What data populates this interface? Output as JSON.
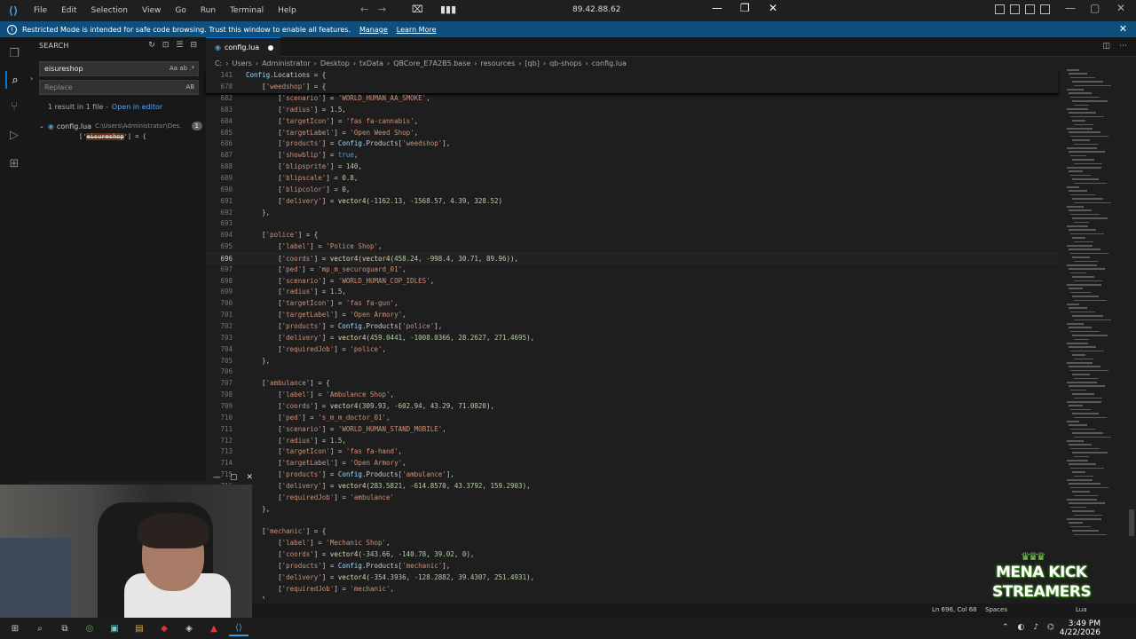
{
  "titlebar": {
    "menu": [
      "File",
      "Edit",
      "Selection",
      "View",
      "Go",
      "Run",
      "Terminal",
      "Help"
    ],
    "remote_address": "89.42.88.62"
  },
  "banner": {
    "message": "Restricted Mode is intended for safe code browsing. Trust this window to enable all features.",
    "manage": "Manage",
    "learn_more": "Learn More"
  },
  "sidebar": {
    "title": "SEARCH",
    "search_value": "eisureshop",
    "search_opts": "Aa ab .*",
    "replace_placeholder": "Replace",
    "replace_opts": "AB",
    "results_text": "1 result in 1 file -",
    "open_in_editor": "Open in editor",
    "file_name": "config.lua",
    "file_path": "C:\\Users\\Administrator\\Des...",
    "file_count": "1",
    "match_prefix": "['",
    "match_hl": "eisureshop",
    "match_suffix": "'] = {"
  },
  "tab": {
    "label": "config.lua"
  },
  "breadcrumb": [
    "C:",
    "Users",
    "Administrator",
    "Desktop",
    "txData",
    "QBCore_E7A2B5.base",
    "resources",
    "[qb]",
    "qb-shops",
    "config.lua"
  ],
  "sticky": [
    {
      "num": "141",
      "text": "Config.Locations = {"
    },
    {
      "num": "678",
      "text": "    ['weedshop'] = {"
    }
  ],
  "code": [
    {
      "num": "682",
      "text": "        ['scenario'] = 'WORLD_HUMAN_AA_SMOKE',"
    },
    {
      "num": "683",
      "text": "        ['radius'] = 1.5,"
    },
    {
      "num": "684",
      "text": "        ['targetIcon'] = 'fas fa-cannabis',"
    },
    {
      "num": "685",
      "text": "        ['targetLabel'] = 'Open Weed Shop',"
    },
    {
      "num": "686",
      "text": "        ['products'] = Config.Products['weedshop'],"
    },
    {
      "num": "687",
      "text": "        ['showblip'] = true,"
    },
    {
      "num": "688",
      "text": "        ['blipsprite'] = 140,"
    },
    {
      "num": "689",
      "text": "        ['blipscale'] = 0.8,"
    },
    {
      "num": "690",
      "text": "        ['blipcolor'] = 0,"
    },
    {
      "num": "691",
      "text": "        ['delivery'] = vector4(-1162.13, -1568.57, 4.39, 328.52)"
    },
    {
      "num": "692",
      "text": "    },"
    },
    {
      "num": "693",
      "text": ""
    },
    {
      "num": "694",
      "text": "    ['police'] = {"
    },
    {
      "num": "695",
      "text": "        ['label'] = 'Police Shop',"
    },
    {
      "num": "696",
      "text": "        ['coords'] = vector4(vector4(458.24, -998.4, 30.71, 89.96)),"
    },
    {
      "num": "697",
      "text": "        ['ped'] = 'mp_m_securoguard_01',"
    },
    {
      "num": "698",
      "text": "        ['scenario'] = 'WORLD_HUMAN_COP_IDLES',"
    },
    {
      "num": "699",
      "text": "        ['radius'] = 1.5,"
    },
    {
      "num": "700",
      "text": "        ['targetIcon'] = 'fas fa-gun',"
    },
    {
      "num": "701",
      "text": "        ['targetLabel'] = 'Open Armory',"
    },
    {
      "num": "702",
      "text": "        ['products'] = Config.Products['police'],"
    },
    {
      "num": "703",
      "text": "        ['delivery'] = vector4(459.0441, -1008.0366, 28.2627, 271.4695),"
    },
    {
      "num": "704",
      "text": "        ['requiredJob'] = 'police',"
    },
    {
      "num": "705",
      "text": "    },"
    },
    {
      "num": "706",
      "text": ""
    },
    {
      "num": "707",
      "text": "    ['ambulance'] = {"
    },
    {
      "num": "708",
      "text": "        ['label'] = 'Ambulance Shop',"
    },
    {
      "num": "709",
      "text": "        ['coords'] = vector4(309.93, -602.94, 43.29, 71.0820),"
    },
    {
      "num": "710",
      "text": "        ['ped'] = 's_m_m_doctor_01',"
    },
    {
      "num": "711",
      "text": "        ['scenario'] = 'WORLD_HUMAN_STAND_MOBILE',"
    },
    {
      "num": "712",
      "text": "        ['radius'] = 1.5,"
    },
    {
      "num": "713",
      "text": "        ['targetIcon'] = 'fas fa-hand',"
    },
    {
      "num": "714",
      "text": "        ['targetLabel'] = 'Open Armory',"
    },
    {
      "num": "715",
      "text": "        ['products'] = Config.Products['ambulance'],"
    },
    {
      "num": "716",
      "text": "        ['delivery'] = vector4(283.5821, -614.8570, 43.3792, 159.2903),"
    },
    {
      "num": "717",
      "text": "        ['requiredJob'] = 'ambulance'"
    },
    {
      "num": "718",
      "text": "    },"
    },
    {
      "num": "719",
      "text": ""
    },
    {
      "num": "720",
      "text": "    ['mechanic'] = {"
    },
    {
      "num": "721",
      "text": "        ['label'] = 'Mechanic Shop',"
    },
    {
      "num": "722",
      "text": "        ['coords'] = vector4(-343.66, -140.78, 39.02, 0),"
    },
    {
      "num": "723",
      "text": "        ['products'] = Config.Products['mechanic'],"
    },
    {
      "num": "724",
      "text": "        ['delivery'] = vector4(-354.3936, -128.2882, 39.4307, 251.4931),"
    },
    {
      "num": "725",
      "text": "        ['requiredJob'] = 'mechanic',"
    },
    {
      "num": "726",
      "text": "    },"
    }
  ],
  "statusbar": {
    "position": "Ln 696, Col 68",
    "spaces": "Spaces",
    "language": "Lua"
  },
  "taskbar": {
    "time": "3:49 PM",
    "date": "4/22/2026"
  },
  "overlay": {
    "line1": "MENA KICK",
    "line2": "STREAMERS"
  }
}
